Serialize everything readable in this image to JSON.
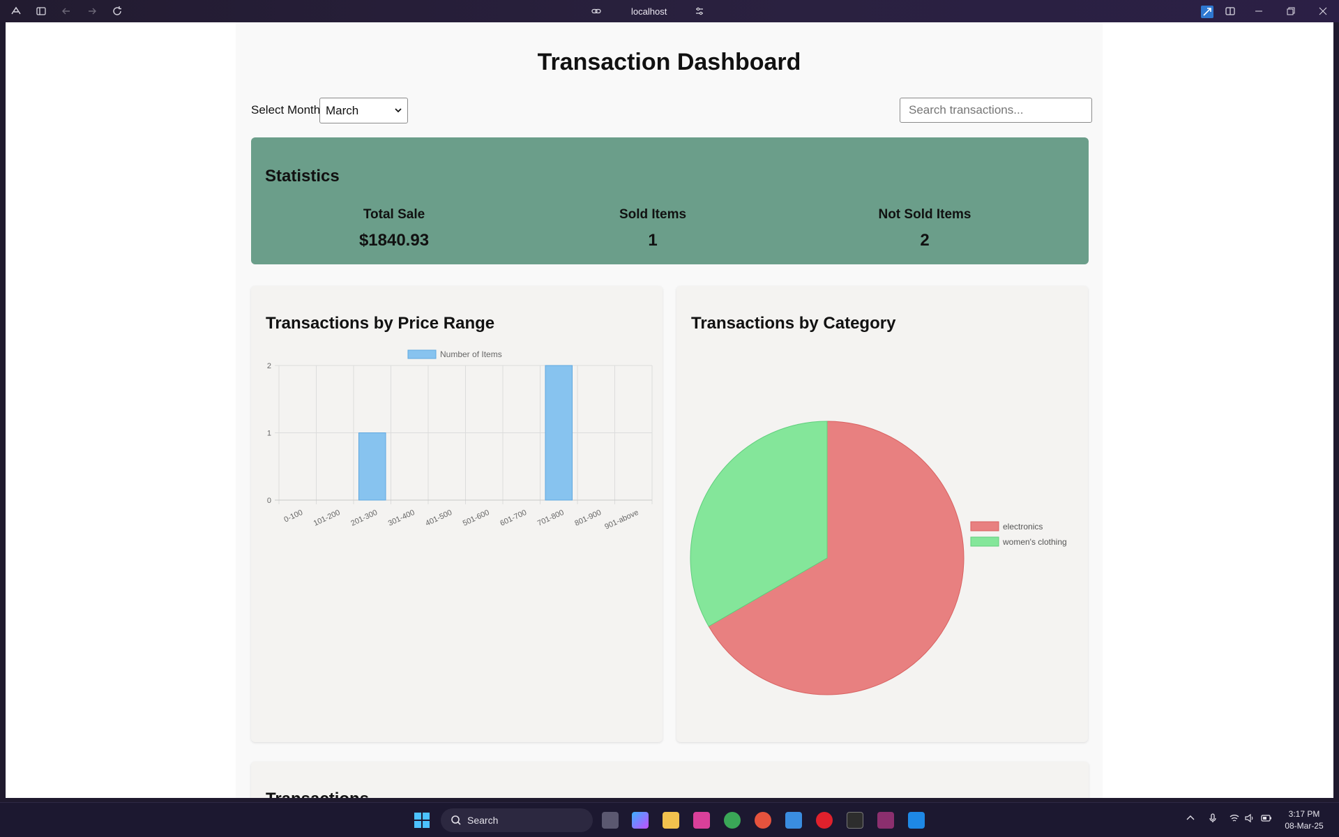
{
  "browser": {
    "address": "localhost"
  },
  "page": {
    "title": "Transaction Dashboard",
    "month_label": "Select Month:",
    "month_selected": "March",
    "search_placeholder": "Search transactions..."
  },
  "statistics": {
    "title": "Statistics",
    "total_sale_label": "Total Sale",
    "total_sale_value": "$1840.93",
    "sold_label": "Sold Items",
    "sold_value": "1",
    "not_sold_label": "Not Sold Items",
    "not_sold_value": "2"
  },
  "bar_card": {
    "title": "Transactions by Price Range"
  },
  "pie_card": {
    "title": "Transactions by Category"
  },
  "transactions_card": {
    "title": "Transactions"
  },
  "chart_data": [
    {
      "type": "bar",
      "categories": [
        "0-100",
        "101-200",
        "201-300",
        "301-400",
        "401-500",
        "501-600",
        "601-700",
        "701-800",
        "801-900",
        "901-above"
      ],
      "series": [
        {
          "name": "Number of Items",
          "values": [
            0,
            0,
            1,
            0,
            0,
            0,
            0,
            2,
            0,
            0
          ]
        }
      ],
      "ylim": [
        0,
        2
      ],
      "yticks": [
        0,
        1,
        2
      ],
      "grid": true,
      "legend": "top",
      "colors": {
        "fill": "#87c3ef",
        "stroke": "#5fa8e0"
      }
    },
    {
      "type": "pie",
      "labels": [
        "electronics",
        "women's clothing"
      ],
      "values": [
        2,
        1
      ],
      "legend": "right",
      "colors": [
        "#e88080",
        "#84e69a"
      ]
    }
  ],
  "taskbar": {
    "search_label": "Search",
    "time": "3:17 PM",
    "date": "08-Mar-25"
  }
}
